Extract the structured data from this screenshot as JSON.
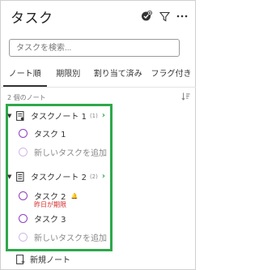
{
  "header": {
    "title": "タスク",
    "icons": [
      "check-add-icon",
      "filter-icon",
      "more-icon"
    ]
  },
  "search": {
    "placeholder": "タスクを検索..."
  },
  "tabs": [
    {
      "label": "ノート順",
      "active": true
    },
    {
      "label": "期限別",
      "active": false
    },
    {
      "label": "割り当て済み",
      "active": false
    },
    {
      "label": "フラグ付き",
      "active": false
    }
  ],
  "section": {
    "count_label": "2 個のノート",
    "sort_icon": "sort-icon"
  },
  "notes": [
    {
      "title": "タスクノート 1",
      "count": "(1)",
      "tasks": [
        {
          "title": "タスク 1"
        }
      ],
      "add_label": "新しいタスクを追加"
    },
    {
      "title": "タスクノート 2",
      "count": "(2)",
      "tasks": [
        {
          "title": "タスク 2",
          "due": "昨日が期限"
        },
        {
          "title": "タスク 3"
        }
      ],
      "add_label": "新しいタスクを追加"
    }
  ],
  "new_note": {
    "label": "新規ノート"
  },
  "colors": {
    "accent": "#8e3fbf",
    "highlight": "#2ea84a",
    "due": "#d42b2b"
  }
}
